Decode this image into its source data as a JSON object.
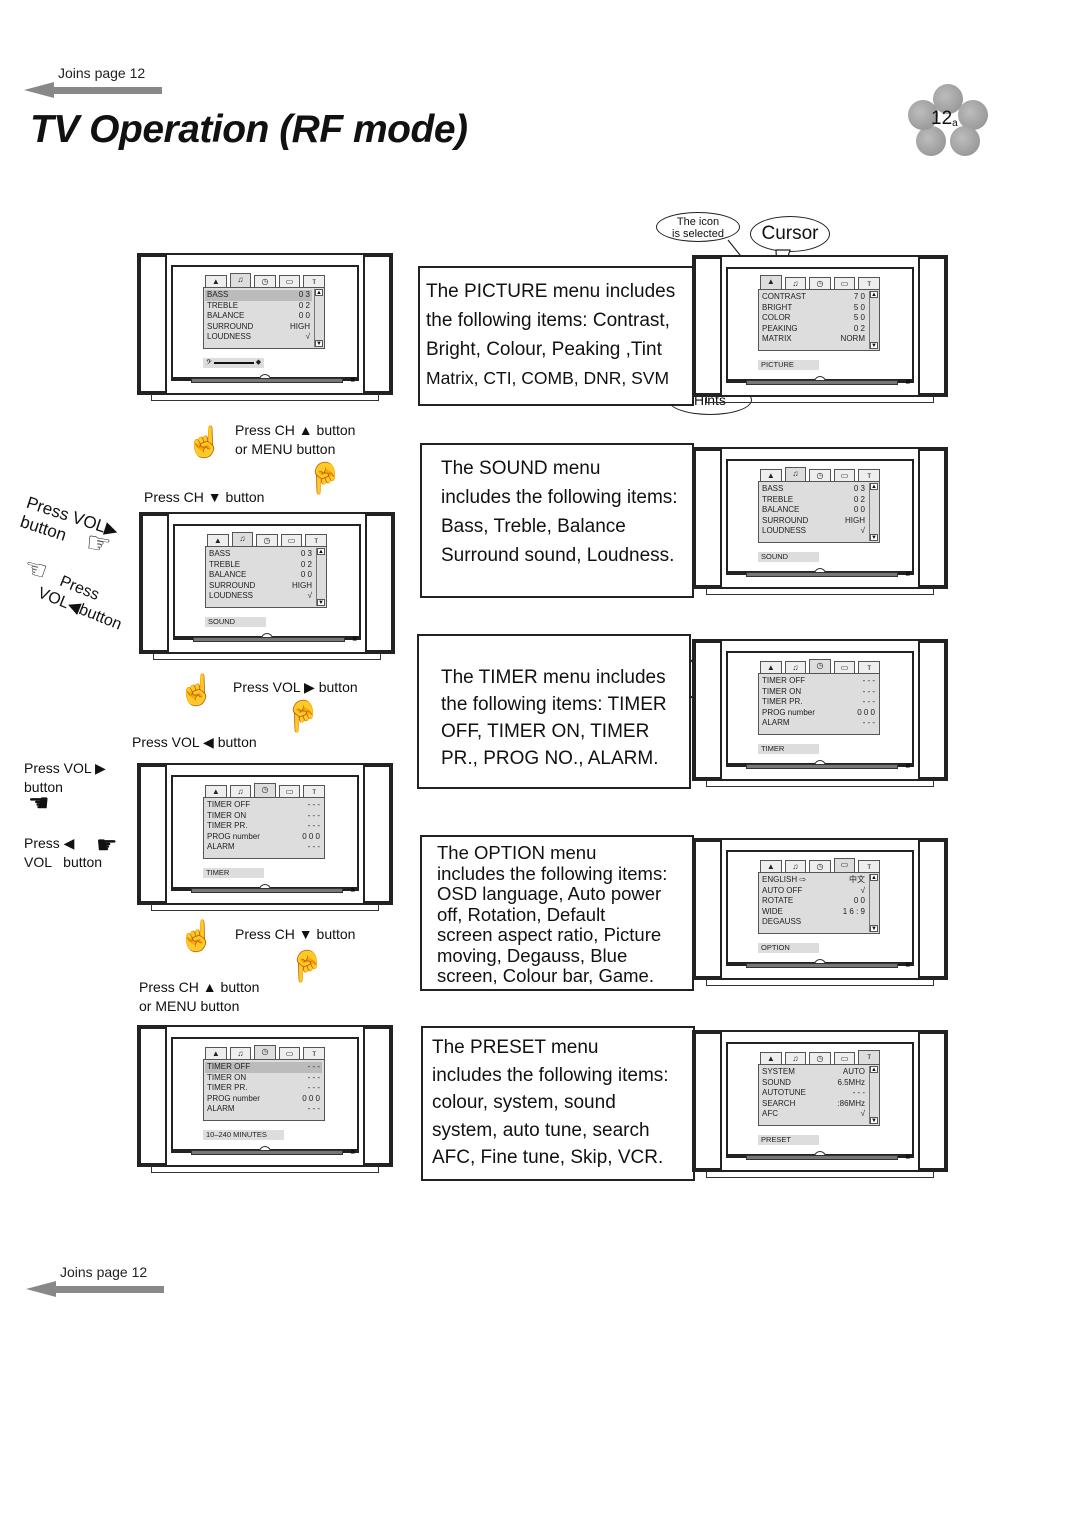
{
  "header": {
    "joins_label": "Joins page 12",
    "title": "TV Operation (RF mode)",
    "page_badge": "12",
    "page_badge_suffix": "a"
  },
  "footer": {
    "joins_label": "Joins page 12"
  },
  "annotations": {
    "icon_selected": [
      "The icon",
      "is selected"
    ],
    "cursor": "Cursor",
    "hints": "Hints"
  },
  "tab_icons": [
    "picture-icon",
    "sound-icon",
    "timer-icon",
    "option-icon",
    "preset-icon"
  ],
  "tab_glyphs": [
    "▲",
    "♫",
    "◷",
    "▭",
    "ᴛ"
  ],
  "left_column": {
    "tv1": {
      "selected_tab": 1,
      "rows": [
        {
          "label": "BASS",
          "value": "0 3"
        },
        {
          "label": "TREBLE",
          "value": "0 2"
        },
        {
          "label": "BALANCE",
          "value": "0 0"
        },
        {
          "label": "SURROUND",
          "value": "HIGH"
        },
        {
          "label": "LOUDNESS",
          "value": "√"
        }
      ],
      "hint": "bass-level-bar"
    },
    "tv2": {
      "selected_tab": 1,
      "rows": [
        {
          "label": "BASS",
          "value": "0 3"
        },
        {
          "label": "TREBLE",
          "value": "0 2"
        },
        {
          "label": "BALANCE",
          "value": "0 0"
        },
        {
          "label": "SURROUND",
          "value": "HIGH"
        },
        {
          "label": "LOUDNESS",
          "value": "√"
        }
      ],
      "hint": "SOUND"
    },
    "tv3": {
      "selected_tab": 2,
      "rows": [
        {
          "label": "TIMER OFF",
          "value": "- - -"
        },
        {
          "label": "TIMER ON",
          "value": "- - -"
        },
        {
          "label": "TIMER PR.",
          "value": "- - -"
        },
        {
          "label": "PROG number",
          "value": "0 0 0"
        },
        {
          "label": "ALARM",
          "value": "- - -"
        }
      ],
      "hint": "TIMER"
    },
    "tv4": {
      "selected_tab": 2,
      "rows": [
        {
          "label": "TIMER OFF",
          "value": "- - -"
        },
        {
          "label": "TIMER ON",
          "value": "- - -"
        },
        {
          "label": "TIMER PR.",
          "value": "- - -"
        },
        {
          "label": "PROG number",
          "value": "0 0 0"
        },
        {
          "label": "ALARM",
          "value": "- - -"
        }
      ],
      "hint": "10–240 MINUTES"
    },
    "instructions": {
      "ch_up_menu_1": [
        "Press CH ▲ button",
        "or MENU button"
      ],
      "ch_down_1": "Press CH ▼ button",
      "vol_right_diag": [
        "Press VOL▶",
        "button"
      ],
      "vol_left_diag": [
        "Press",
        "VOL◀button"
      ],
      "vol_right_2": "Press VOL ▶ button",
      "vol_left_2": "Press VOL ◀ button",
      "vol_right_side": [
        "Press VOL ▶",
        "button"
      ],
      "vol_left_side": [
        "Press ◀",
        "VOL   button"
      ],
      "ch_down_2": "Press CH ▼ button",
      "ch_up_menu_2": [
        "Press CH ▲ button",
        "or MENU button"
      ]
    }
  },
  "right_column": [
    {
      "menu": "PICTURE",
      "description": [
        "The PICTURE menu includes",
        "the following items: Contrast,",
        "Bright, Colour, Peaking ,Tint",
        "Matrix, CTI, COMB, DNR, SVM"
      ],
      "selected_tab": 0,
      "rows": [
        {
          "label": "CONTRAST",
          "value": "7 0"
        },
        {
          "label": "BRIGHT",
          "value": "5 0"
        },
        {
          "label": "COLOR",
          "value": "5 0"
        },
        {
          "label": "PEAKING",
          "value": "0 2"
        },
        {
          "label": "MATRIX",
          "value": "NORM"
        }
      ],
      "hint": "PICTURE"
    },
    {
      "menu": "SOUND",
      "description": [
        "The SOUND menu",
        "includes the following items:",
        "Bass, Treble, Balance",
        "Surround sound, Loudness."
      ],
      "selected_tab": 1,
      "rows": [
        {
          "label": "BASS",
          "value": "0 3"
        },
        {
          "label": "TREBLE",
          "value": "0 2"
        },
        {
          "label": "BALANCE",
          "value": "0 0"
        },
        {
          "label": "SURROUND",
          "value": "HIGH"
        },
        {
          "label": "LOUDNESS",
          "value": "√"
        }
      ],
      "hint": "SOUND"
    },
    {
      "menu": "TIMER",
      "description": [
        "The TIMER menu includes",
        "the following items: TIMER",
        "OFF, TIMER ON, TIMER",
        "PR., PROG NO., ALARM."
      ],
      "selected_tab": 2,
      "rows": [
        {
          "label": "TIMER OFF",
          "value": "- - -"
        },
        {
          "label": "TIMER ON",
          "value": "- - -"
        },
        {
          "label": "TIMER PR.",
          "value": "- - -"
        },
        {
          "label": "PROG number",
          "value": "0 0 0"
        },
        {
          "label": "ALARM",
          "value": "- - -"
        }
      ],
      "hint": "TIMER"
    },
    {
      "menu": "OPTION",
      "description": [
        "The OPTION menu",
        "includes the following items:",
        "OSD language, Auto power",
        "off, Rotation, Default",
        "screen aspect ratio, Picture",
        "moving, Degauss, Blue",
        "screen, Colour bar, Game."
      ],
      "selected_tab": 3,
      "rows": [
        {
          "label": "ENGLISH ⇨",
          "value": "中文"
        },
        {
          "label": "AUTO OFF",
          "value": "√"
        },
        {
          "label": "ROTATE",
          "value": "0 0"
        },
        {
          "label": "WIDE",
          "value": "1 6 : 9"
        },
        {
          "label": "DEGAUSS",
          "value": ""
        }
      ],
      "hint": "OPTION"
    },
    {
      "menu": "PRESET",
      "description": [
        "The PRESET menu",
        "includes the following items:",
        "colour, system, sound",
        "system, auto tune, search",
        "AFC, Fine tune, Skip, VCR."
      ],
      "selected_tab": 4,
      "rows": [
        {
          "label": "SYSTEM",
          "value": "AUTO"
        },
        {
          "label": "SOUND",
          "value": "6.5MHz"
        },
        {
          "label": "AUTOTUNE",
          "value": "- - -"
        },
        {
          "label": "SEARCH",
          "value": ":86MHz"
        },
        {
          "label": "AFC",
          "value": "√"
        }
      ],
      "hint": "PRESET"
    }
  ]
}
